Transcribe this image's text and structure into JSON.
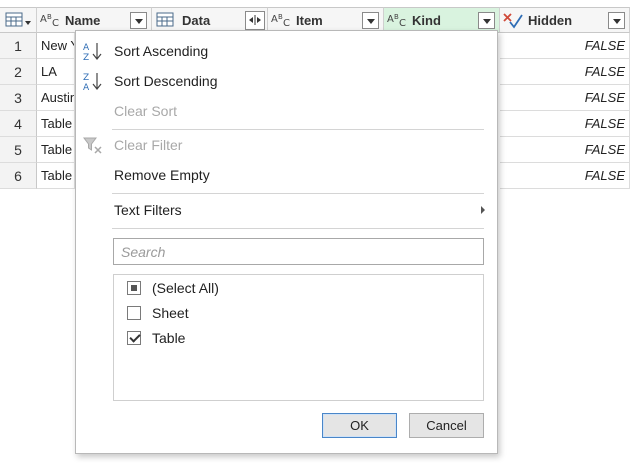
{
  "columns": [
    {
      "label": "Name",
      "type_icon": "text-type-icon",
      "type_text": "ABC"
    },
    {
      "label": "Data",
      "type_icon": "table-type-icon",
      "type_text": ""
    },
    {
      "label": "Item",
      "type_icon": "text-type-icon",
      "type_text": "ABC"
    },
    {
      "label": "Kind",
      "type_icon": "text-type-icon",
      "type_text": "ABC"
    },
    {
      "label": "Hidden",
      "type_icon": "logical-type-icon",
      "type_text": ""
    }
  ],
  "rows": [
    {
      "num": "1",
      "name": "New Y",
      "hidden": "FALSE"
    },
    {
      "num": "2",
      "name": "LA",
      "hidden": "FALSE"
    },
    {
      "num": "3",
      "name": "Austin",
      "hidden": "FALSE"
    },
    {
      "num": "4",
      "name": "Table",
      "hidden": "FALSE"
    },
    {
      "num": "5",
      "name": "Table",
      "hidden": "FALSE"
    },
    {
      "num": "6",
      "name": "Table",
      "hidden": "FALSE"
    }
  ],
  "menu": {
    "sort_asc": "Sort Ascending",
    "sort_desc": "Sort Descending",
    "clear_sort": "Clear Sort",
    "clear_filter": "Clear Filter",
    "remove_empty": "Remove Empty",
    "text_filters": "Text Filters"
  },
  "search": {
    "placeholder": "Search"
  },
  "filter_items": [
    {
      "label": "(Select All)",
      "state": "indeterminate"
    },
    {
      "label": "Sheet",
      "state": "unchecked"
    },
    {
      "label": "Table",
      "state": "checked"
    }
  ],
  "buttons": {
    "ok": "OK",
    "cancel": "Cancel"
  },
  "colors": {
    "selected_header": "#d9f3df",
    "ok_border": "#4a86c8",
    "sort_icon_blue": "#2f6db5",
    "check_blue": "#2f6db5",
    "x_red": "#d04a3a"
  }
}
